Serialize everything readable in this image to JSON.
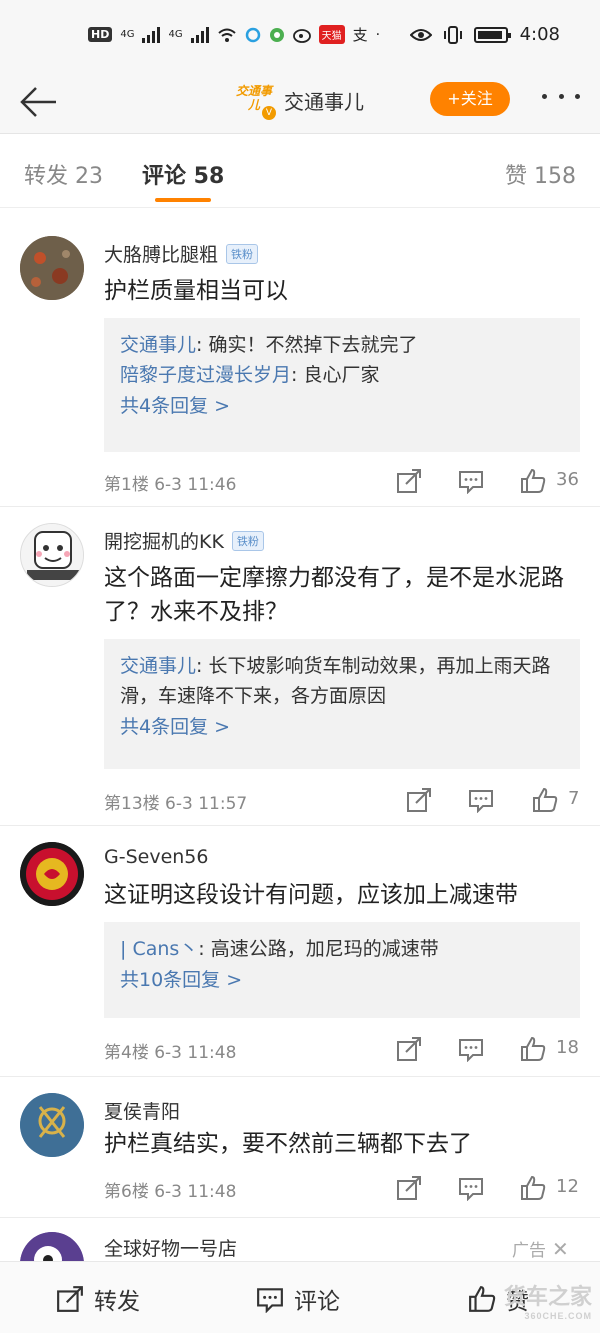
{
  "status_bar": {
    "hd": "HD",
    "sig1": "4G",
    "sig2": "4G",
    "tmall": "天猫",
    "alipay": "支",
    "time": "4:08"
  },
  "header": {
    "logo_text": "交通事儿",
    "title": "交通事儿",
    "follow_label": "+关注"
  },
  "tabs": [
    {
      "label": "转发 23"
    },
    {
      "label": "评论 58"
    },
    {
      "label": "赞 158"
    }
  ],
  "comments": [
    {
      "name": "大胳膊比腿粗",
      "badge": "铁粉",
      "text": "护栏质量相当可以",
      "replies": [
        {
          "user": "交通事儿",
          "text": ": 确实！不然掉下去就完了"
        },
        {
          "user": "陪黎子度过漫长岁月",
          "text": ": 良心厂家"
        }
      ],
      "more": "共4条回复 >",
      "floor": "第1楼  6-3 11:46",
      "likes": "36"
    },
    {
      "name": "開挖掘机的KK",
      "badge": "铁粉",
      "text": "这个路面一定摩擦力都没有了，是不是水泥路了？水来不及排？",
      "replies": [
        {
          "user": "交通事儿",
          "text": ": 长下坡影响货车制动效果，再加上雨天路滑，车速降不下来，各方面原因"
        }
      ],
      "more": "共4条回复 >",
      "floor": "第13楼  6-3 11:57",
      "likes": "7"
    },
    {
      "name": "G-Seven56",
      "text": "这证明这段设计有问题，应该加上减速带",
      "replies": [
        {
          "user": "| Cans丶",
          "text": ": 高速公路，加尼玛的减速带"
        }
      ],
      "more": "共10条回复 >",
      "floor": "第4楼  6-3 11:48",
      "likes": "18"
    },
    {
      "name": "夏侯青阳",
      "text": "护栏真结实，要不然前三辆都下去了",
      "floor": "第6楼  6-3 11:48",
      "likes": "12"
    },
    {
      "name": "全球好物一号店",
      "ad": "广告"
    }
  ],
  "bottom_bar": {
    "repost": "转发",
    "comment": "评论",
    "like": "赞"
  },
  "watermark": {
    "text": "货车之家",
    "sub": "360CHE.COM"
  },
  "colors": {
    "accent": "#ff8200",
    "link": "#4a78b0"
  }
}
